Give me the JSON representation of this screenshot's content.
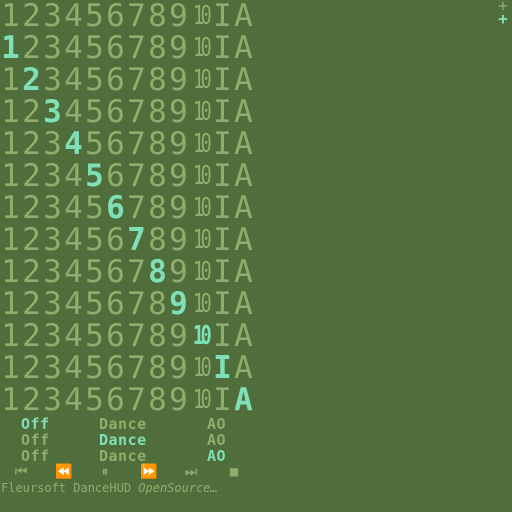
{
  "grid": {
    "labels": [
      "1",
      "2",
      "3",
      "4",
      "5",
      "6",
      "7",
      "8",
      "9",
      "10",
      "I",
      "A"
    ],
    "highlight_per_row": [
      -1,
      0,
      1,
      2,
      3,
      4,
      5,
      6,
      7,
      8,
      9,
      10,
      11
    ],
    "colors": {
      "normal": "#8fae6c",
      "highlight": "#7fe0b8",
      "background": "#4f6e3c"
    }
  },
  "corner": {
    "plus_top": "+",
    "plus_bottom": "+"
  },
  "mode_rows": [
    {
      "off": "Off",
      "dance": "Dance",
      "ao": "AO",
      "highlight": "off"
    },
    {
      "off": "Off",
      "dance": "Dance",
      "ao": "AO",
      "highlight": "dance"
    },
    {
      "off": "Off",
      "dance": "Dance",
      "ao": "AO",
      "highlight": "ao"
    }
  ],
  "transport": [
    {
      "name": "skip-back-icon",
      "glyph": "⏮"
    },
    {
      "name": "rewind-icon",
      "glyph": "⏪"
    },
    {
      "name": "pause-icon",
      "glyph": "⏸"
    },
    {
      "name": "fast-forward-icon",
      "glyph": "⏩"
    },
    {
      "name": "skip-forward-icon",
      "glyph": "⏭"
    },
    {
      "name": "stop-icon",
      "glyph": "■"
    }
  ],
  "footer": {
    "brand": "Fleursoft DanceHUD",
    "tagline": "OpenSource…"
  }
}
